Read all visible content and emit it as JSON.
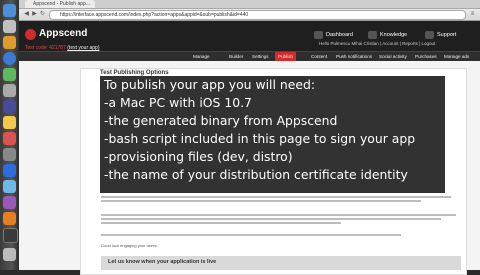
{
  "browser": {
    "tab_title": "Appscend - Publish app...",
    "url": "https://interface.appscend.com/index.php?action=apps&appid=&sub=publish&id=440"
  },
  "header": {
    "logo": "Appscend",
    "test_code_prefix": "Test code: 421787 ",
    "test_code_link": "(test your app)",
    "user_line": "Hello Pulmescu Mihai Cristian | Account | Reports | Logout",
    "buttons": [
      "Dashboard",
      "Knowledge",
      "Support"
    ]
  },
  "nav": {
    "items": [
      "Manage",
      "Builder",
      "Settings",
      "Publish",
      "Content",
      "Push notifications",
      "Social activity",
      "Purchases",
      "Manage ads"
    ]
  },
  "content": {
    "panel_title": "Test Publishing Options",
    "live_box": "Let us know when your application is live",
    "good_luck": "Good luck engaging your users!"
  },
  "overlay": {
    "lines": [
      "To publish your app you will need:",
      "-a Mac PC with iOS 10.7",
      "-the generated binary from Appscend",
      "-bash script included in this page to sign your app",
      "-provisioning files (dev, distro)",
      "-the name of your distribution certificate identity"
    ]
  },
  "colors": {
    "brand": "#d42a2a",
    "header": "#1f1f1f",
    "overlay": "#101010"
  }
}
